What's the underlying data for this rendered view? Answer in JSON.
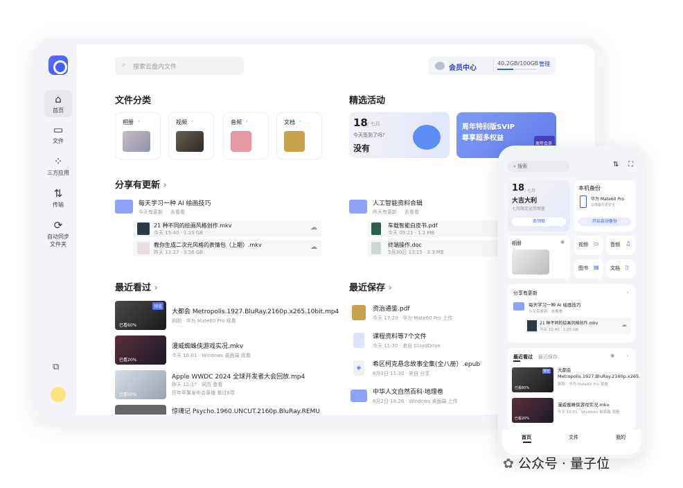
{
  "sidebar": {
    "items": [
      {
        "label": "首页"
      },
      {
        "label": "文件"
      },
      {
        "label": "三方应用"
      },
      {
        "label": "传输"
      },
      {
        "label": "自动同步 文件夹"
      }
    ]
  },
  "search": {
    "placeholder": "搜索云盘内文件"
  },
  "vip": {
    "label": "会员中心",
    "storage": "40.2GB/100GB",
    "progress": 0.402,
    "manage": "管理"
  },
  "categories": {
    "title": "文件分类",
    "items": [
      {
        "label": "相册"
      },
      {
        "label": "视频"
      },
      {
        "label": "音频"
      },
      {
        "label": "文档"
      }
    ]
  },
  "activity": {
    "title": "精选活动",
    "day": "18",
    "month": "/ 七月",
    "question": "今天签到了吗?",
    "answer": "没有",
    "banner_line1": "周年特别版SVIP",
    "banner_line2": "尊享超多权益",
    "badge": "周年会员"
  },
  "share": {
    "title": "分享有更新",
    "groups": [
      {
        "name": "每天学习一种 AI 绘画技巧",
        "meta": "今天有更新",
        "go": "去看看",
        "files": [
          {
            "name": "21 种不同的绘画风格创作.mkv",
            "meta": "今天 15:40 · 1.25 GB"
          },
          {
            "name": "教你生成二次元风格的表情包（上期）.mkv",
            "meta": "昨天 13:27 · 3.56 GB"
          }
        ]
      },
      {
        "name": "人工智能资料合辑",
        "meta": "昨天有更新",
        "go": "去看看",
        "files": [
          {
            "name": "车载智能白皮书.pdf",
            "meta": "今天 09:21 · 1.2 MB"
          },
          {
            "name": "终端操作.doc",
            "meta": "5月30日 13:15 · 3.3 MB"
          }
        ]
      }
    ]
  },
  "recent_watch": {
    "title": "最近看过",
    "items": [
      {
        "name": "大都会 Metropolis.1927.BluRay.2160p.x265.10bit.mp4",
        "meta": "刚刚 · 华为 Mate60 Pro 观看",
        "progress": "已看60%",
        "badge": "预览"
      },
      {
        "name": "漫威蜘蛛侠游戏实况.mkv",
        "meta": "今天 16:01 · Windows 桌面端 观看",
        "progress": "已看20%"
      },
      {
        "name": "Apple WWDC 2024 全球开发者大会回放.mp4",
        "meta": "昨天 12:37 · 网页 查看",
        "extra": "历年苹果发布会录播  看过8项",
        "progress": "已看50%"
      },
      {
        "name": "惊魂记 Psycho.1960.UNCUT.2160p.BluRay.REMU",
        "meta": ""
      }
    ]
  },
  "recent_save": {
    "title": "最近保存",
    "items": [
      {
        "name": "资治通鉴.pdf",
        "meta": "今天 17:20 · 华为 Mate60 Pro 上传"
      },
      {
        "name": "课程资料等7个文件",
        "meta": "今天 11:30 · 来自 CloudDrive"
      },
      {
        "name": "希区柯克悬念故事全集(全八册）.epub",
        "meta": "6月3日 11:30 · 来自 分享"
      },
      {
        "name": "中华人文自然百科·地理卷",
        "meta": "6月2日 18:26 · Windows 桌面端 上传"
      }
    ]
  },
  "phone": {
    "search": "搜索",
    "day": "18",
    "month": "/ 七月",
    "title": "大吉大利",
    "sub": "七月限定运势图鉴",
    "btn1": "去领取",
    "backup_title": "本机备份",
    "device": "华为 Mate60 Pro",
    "backup_sub": "云端备份更安全",
    "btn2": "开启自动备份",
    "album": "相册",
    "video": "视频",
    "audio": "音频",
    "pics": "图书",
    "docs": "文档",
    "share_title": "分享有更新",
    "share_group": "每天学习一种 AI 绘画技巧",
    "share_meta": "今天有更新 · 去看看",
    "share_file": "21 种不同的绘画风格创作.mkv",
    "share_file_meta": "今天 15:40 · 1.25 GB",
    "tab_watch": "最近看过",
    "tab_save": "最近保存",
    "w1": "大都会 Metropolis.1927.BluRay.2160p.x265.10bit.mp4",
    "w1meta": "刚刚 · 华为 Mate60 Pro 观看",
    "w1p": "已看60%",
    "w1b": "预览",
    "w2": "漫威蜘蛛侠游戏实况.mkv",
    "w2meta": "今天 16:01 · Windows 桌面端 观看",
    "w2p": "已看20%",
    "nav": [
      "首页",
      "文件",
      "我的"
    ]
  },
  "watermark": "公众号 · 量子位"
}
